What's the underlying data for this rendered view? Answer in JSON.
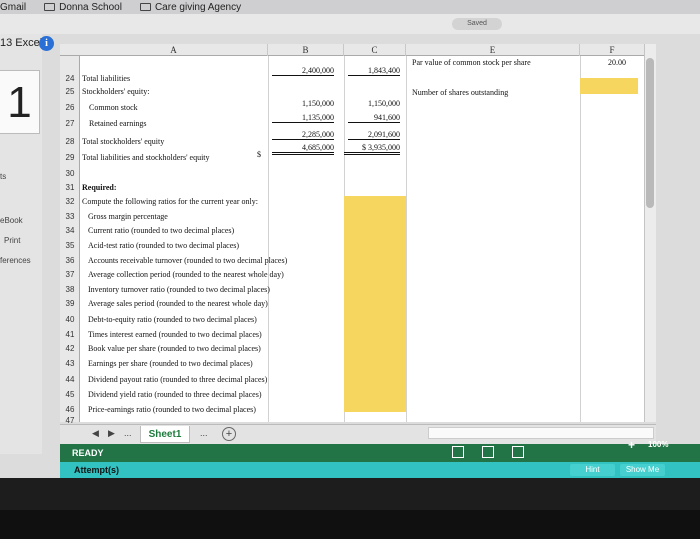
{
  "browser": {
    "bookmarks": [
      "Gmail",
      "Donna School",
      "Care giving Agency"
    ],
    "saved_status": "Saved"
  },
  "side": {
    "question_title": "13 Excel",
    "question_number": "1",
    "items": [
      "ts",
      "eBook",
      "Print",
      "ferences"
    ]
  },
  "sheet": {
    "columns": [
      "A",
      "B",
      "C",
      "E",
      "F"
    ],
    "row_numbers": [
      "24",
      "25",
      "26",
      "27",
      "28",
      "29",
      "30",
      "31",
      "32",
      "33",
      "34",
      "35",
      "36",
      "37",
      "38",
      "39",
      "40",
      "41",
      "42",
      "43",
      "44",
      "45",
      "46",
      "47"
    ],
    "top_row": {
      "b": "2,400,000",
      "c": "1,843,400",
      "e": "Par value of common stock per share",
      "f": "20.00"
    },
    "e_label2": "Number of shares outstanding",
    "rows": [
      {
        "label": "Total liabilities",
        "b": "",
        "c": ""
      },
      {
        "label": "Stockholders' equity:",
        "b": "",
        "c": ""
      },
      {
        "label": "Common stock",
        "b": "1,150,000",
        "c": "1,150,000"
      },
      {
        "label": "Retained earnings",
        "b": "1,135,000",
        "c": "941,600"
      },
      {
        "label": "Total stockholders' equity",
        "b": "2,285,000",
        "c": "2,091,600"
      },
      {
        "label": "Total liabilities and stockholders' equity",
        "dollar": "$",
        "b": "4,685,000",
        "c": "$ 3,935,000"
      }
    ],
    "required": "Required:",
    "instruction": "Compute the following ratios for the current year only:",
    "ratios": [
      "Gross margin percentage",
      "Current ratio (rounded to two decimal places)",
      "Acid-test ratio (rounded to two decimal places)",
      "Accounts receivable turnover (rounded to two decimal places)",
      "Average collection period (rounded to the nearest whole day)",
      "Inventory turnover ratio (rounded to two decimal places)",
      "Average sales period (rounded to the nearest whole day)",
      "Debt-to-equity ratio (rounded to two decimal places)",
      "Times interest earned (rounded to two decimal places)",
      "Book value per share (rounded to two decimal places)",
      "Earnings per share (rounded to two decimal places)",
      "Dividend payout ratio (rounded to three decimal places)",
      "Dividend yield ratio (rounded to three decimal places)",
      "Price-earnings ratio (rounded to two decimal places)"
    ]
  },
  "tabs": {
    "ellipsis": "...",
    "sheet_name": "Sheet1",
    "ellipsis2": "...",
    "add": "+"
  },
  "status": {
    "ready": "READY",
    "zoom": "100%",
    "zoom_plus": "+"
  },
  "attempt": {
    "label": "Attempt(s)",
    "hint": "Hint",
    "show_me": "Show Me"
  },
  "colors": {
    "highlight": "#f6d65e",
    "excel_green": "#227447",
    "teal": "#32c2c2"
  }
}
